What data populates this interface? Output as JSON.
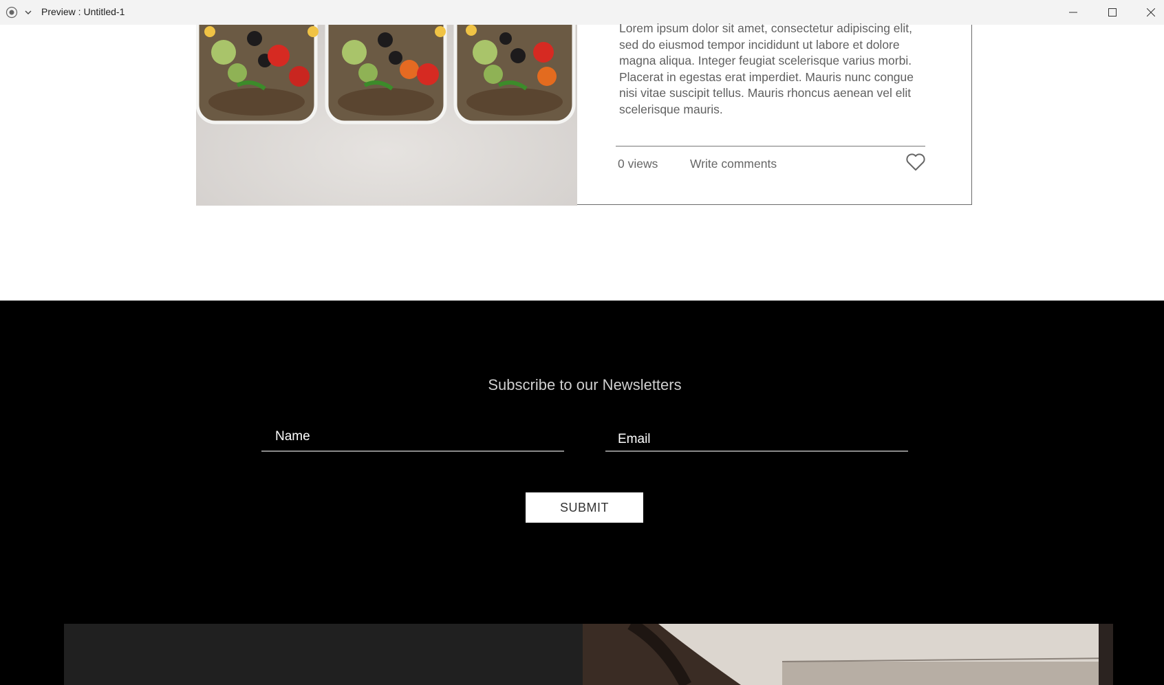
{
  "window": {
    "title": "Preview : Untitled-1",
    "icons": [
      "record-icon",
      "chevron-down-icon",
      "minimize-icon",
      "maximize-icon",
      "close-icon"
    ]
  },
  "post": {
    "excerpt": "Lorem ipsum dolor sit amet, consectetur adipiscing elit, sed do eiusmod tempor incididunt ut labore et dolore magna aliqua. Integer feugiat scelerisque varius morbi. Placerat in egestas erat imperdiet. Mauris nunc congue nisi vitae suscipit tellus. Mauris rhoncus aenean vel elit scelerisque mauris.",
    "views": "0 views",
    "comments_link": "Write comments",
    "like_icon": "heart-icon"
  },
  "newsletter": {
    "title": "Subscribe to our Newsletters",
    "name_placeholder": "Name",
    "email_placeholder": "Email",
    "submit_label": "SUBMIT"
  },
  "colors": {
    "titlebar": "#f3f3f3",
    "newsletter_bg": "#000000",
    "panel_dark": "#202020"
  }
}
